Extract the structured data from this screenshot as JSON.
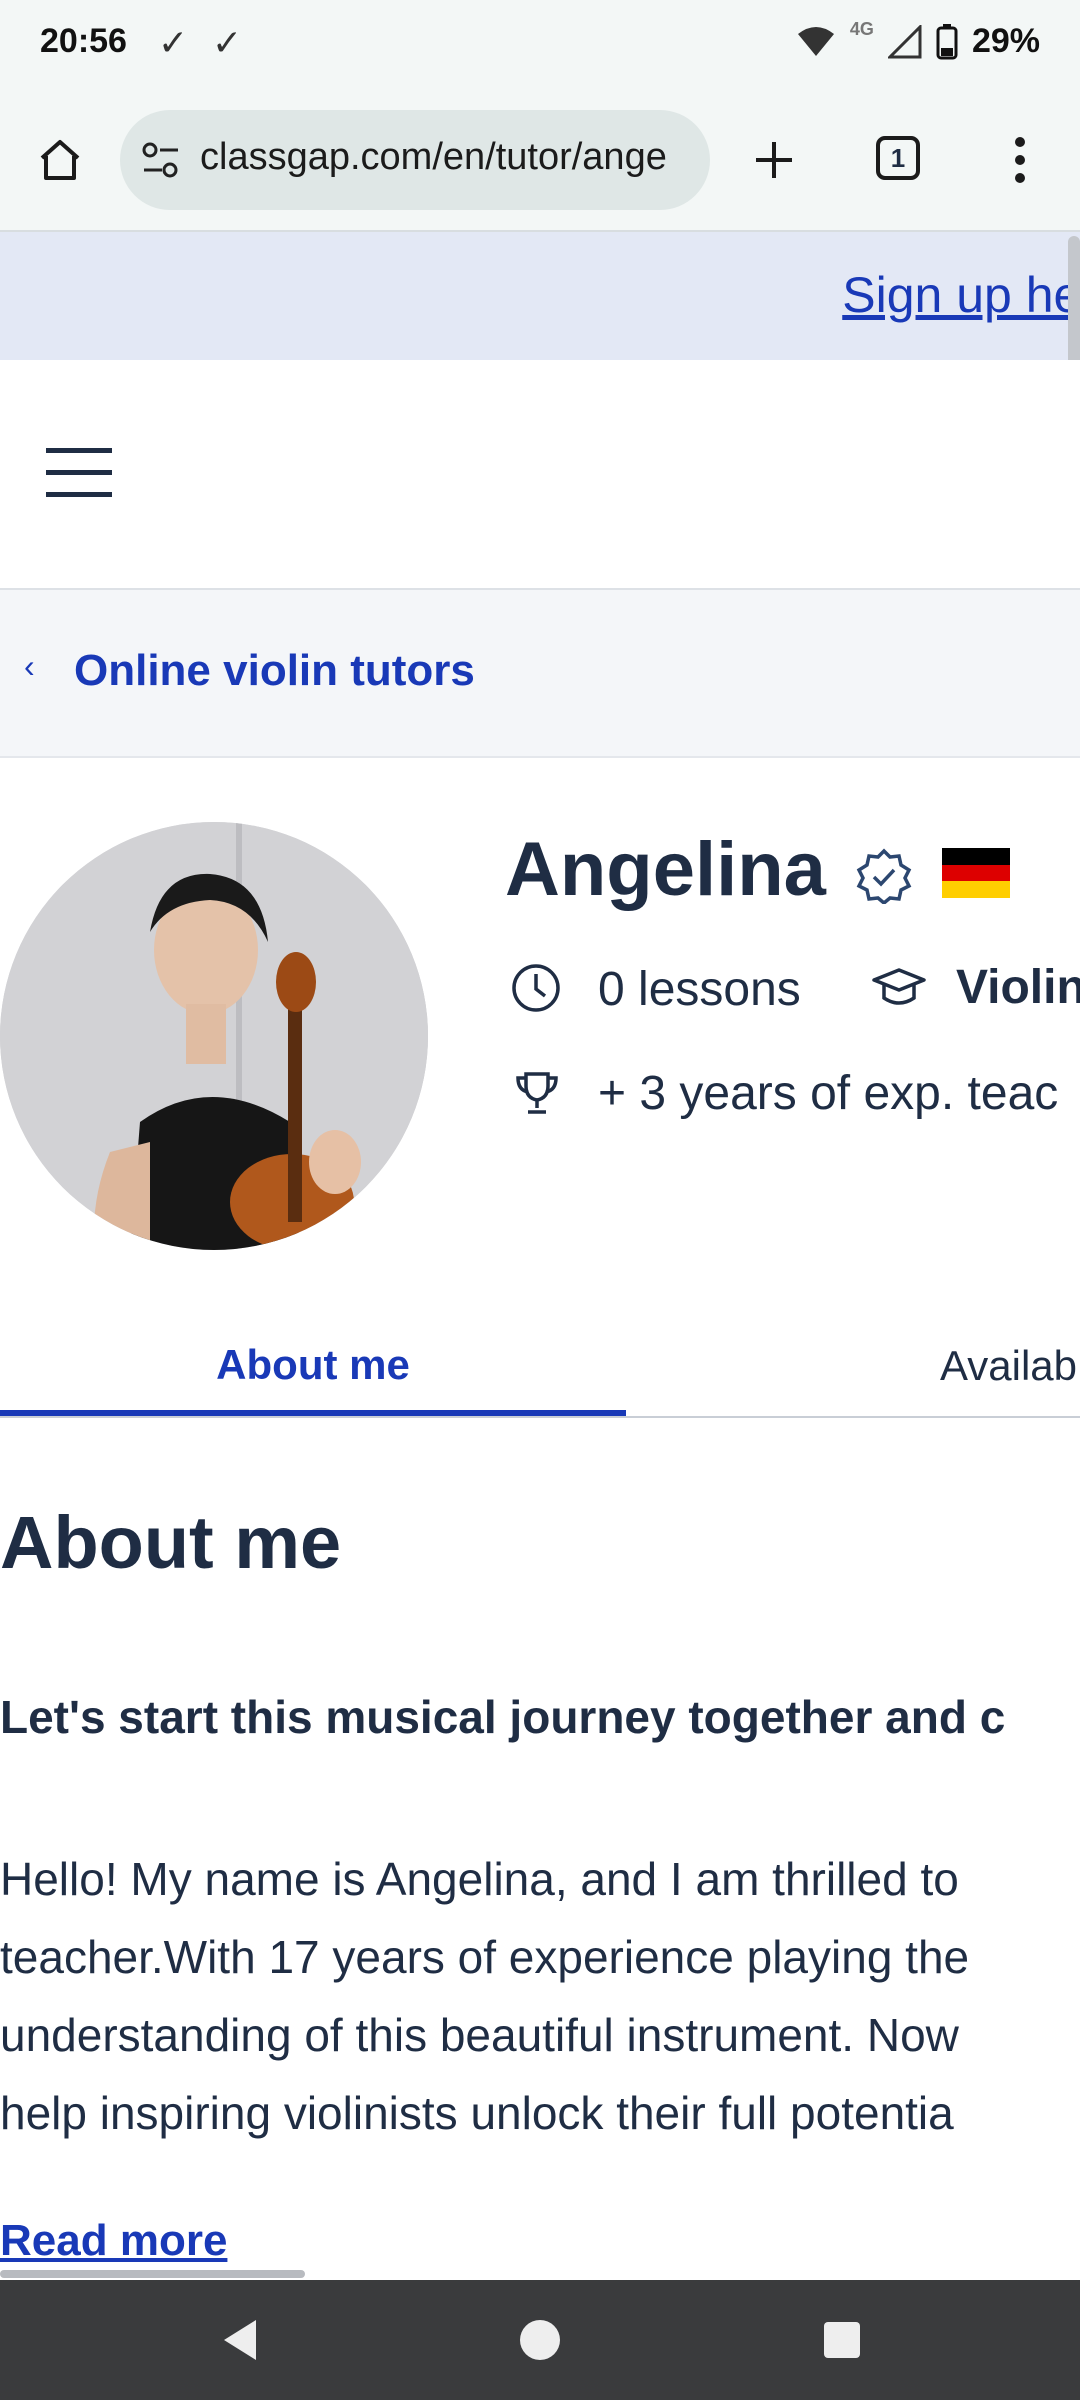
{
  "status_bar": {
    "time": "20:56",
    "battery": "29%",
    "network": "4G"
  },
  "browser": {
    "url": "classgap.com/en/tutor/angе",
    "tab_count": "1"
  },
  "banner": {
    "signup_text": "Sign up her"
  },
  "breadcrumb": {
    "label": "Online violin tutors"
  },
  "profile": {
    "name": "Angelina",
    "lessons": "0 lessons",
    "subject": "Violin",
    "experience": "+ 3 years of exp. teac"
  },
  "tabs": {
    "about": "About me",
    "availability": "Availab"
  },
  "about": {
    "heading": "About me",
    "lead": "Let's start this musical journey together and c",
    "paragraph": "Hello! My name is Angelina, and I am thrilled to\nteacher.With 17 years of experience playing the\nunderstanding of this beautiful instrument. Now\nhelp inspiring violinists unlock their full potentia",
    "read_more": "Read more"
  },
  "colors": {
    "accent": "#1939b7",
    "text": "#1f2d44",
    "banner_bg": "#e3e8f5"
  }
}
